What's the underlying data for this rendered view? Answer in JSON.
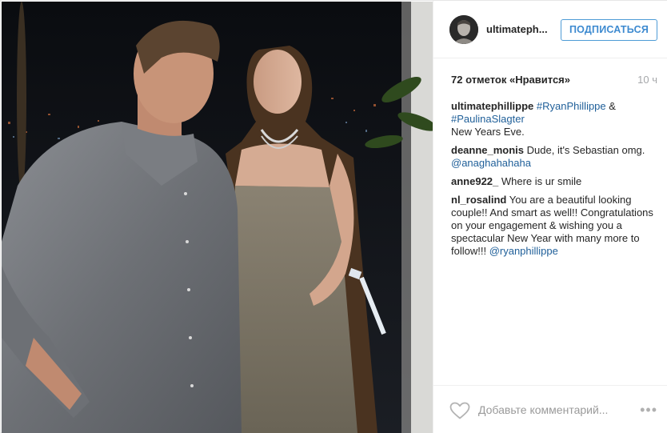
{
  "post": {
    "username": "ultimateph...",
    "follow_label": "ПОДПИСАТЬСЯ",
    "likes": "72 отметок «Нравится»",
    "time": "10 ч",
    "caption": {
      "user": "ultimatephillippe",
      "hashtag1": "#RyanPhillippe",
      "amp": " & ",
      "hashtag2": "#PaulinaSlagter",
      "text": "New Years Eve."
    },
    "comments": [
      {
        "user": "deanne_monis",
        "text": " Dude, it's Sebastian omg.",
        "mention": "@anaghahahaha"
      },
      {
        "user": "anne922_",
        "text": " Where is ur smile"
      },
      {
        "user": "nl_rosalind",
        "text": " You are a beautiful looking couple!! And smart as well!! Congratulations on your engagement & wishing you a spectacular New Year with many more to follow!!! ",
        "mention": "@ryanphillippe"
      }
    ],
    "add_comment_placeholder": "Добавьте комментарий...",
    "more_label": "•••",
    "icons": {
      "like": "heart-icon",
      "more": "more-options-icon"
    },
    "colors": {
      "follow_border": "#4e9bd6",
      "link": "#1f5f99",
      "muted": "#a5a7aa"
    }
  }
}
